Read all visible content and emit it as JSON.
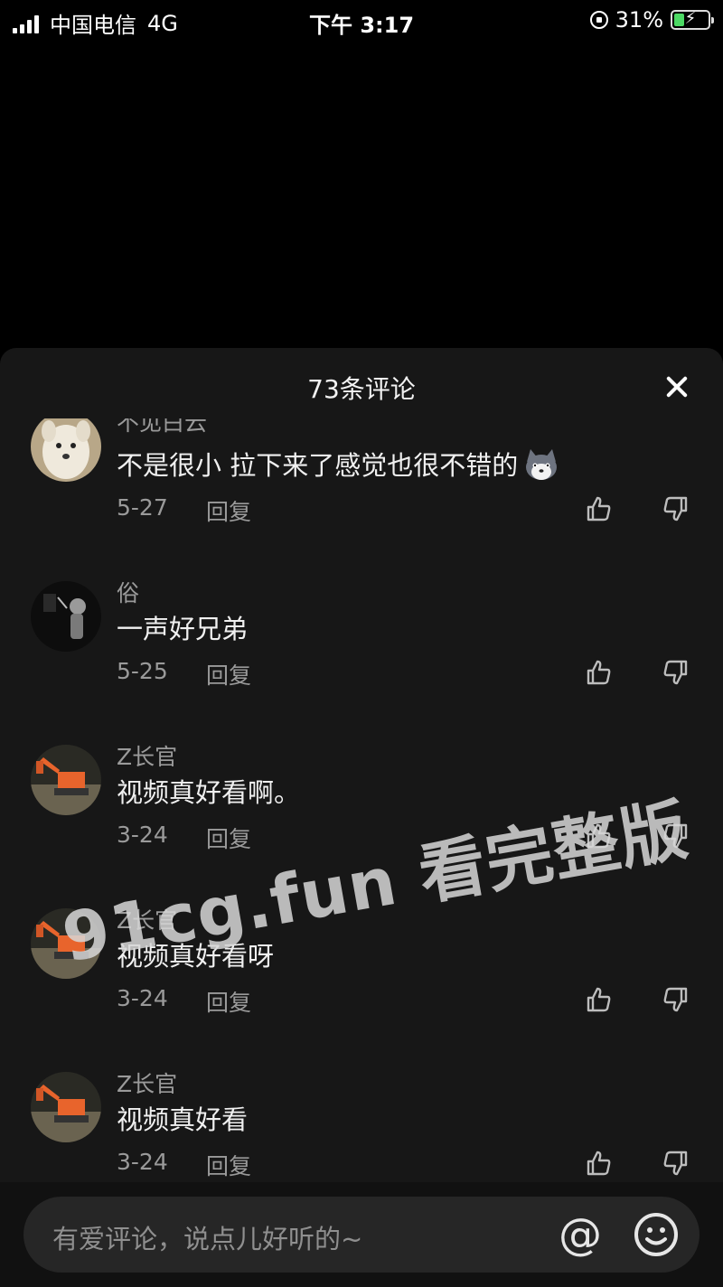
{
  "status_bar": {
    "carrier": "中国电信",
    "network": "4G",
    "time": "下午 3:17",
    "battery_percent": "31%",
    "battery_level": 0.31
  },
  "sheet": {
    "title": "73条评论",
    "close_icon": "close-icon"
  },
  "comments": [
    {
      "user": "不见白云",
      "text": "不是很小 拉下来了感觉也很不错的",
      "emoji": "husky-emoji",
      "date": "5-27",
      "reply": "回复",
      "avatar": "white-dog"
    },
    {
      "user": "俗",
      "text": "一声好兄弟",
      "date": "5-25",
      "reply": "回复",
      "avatar": "dark-figure"
    },
    {
      "user": "Z长官",
      "text": "视频真好看啊。",
      "date": "3-24",
      "reply": "回复",
      "avatar": "excavator"
    },
    {
      "user": "Z长官",
      "text": "视频真好看呀",
      "date": "3-24",
      "reply": "回复",
      "avatar": "excavator"
    },
    {
      "user": "Z长官",
      "text": "视频真好看",
      "date": "3-24",
      "reply": "回复",
      "avatar": "excavator"
    }
  ],
  "watermark": "91cg.fun 看完整版",
  "input": {
    "placeholder": "有爱评论，说点儿好听的~",
    "at_symbol": "@"
  },
  "colors": {
    "sheet_bg": "#171717",
    "meta_text": "#9a9a9a",
    "battery_green": "#4cd964"
  }
}
